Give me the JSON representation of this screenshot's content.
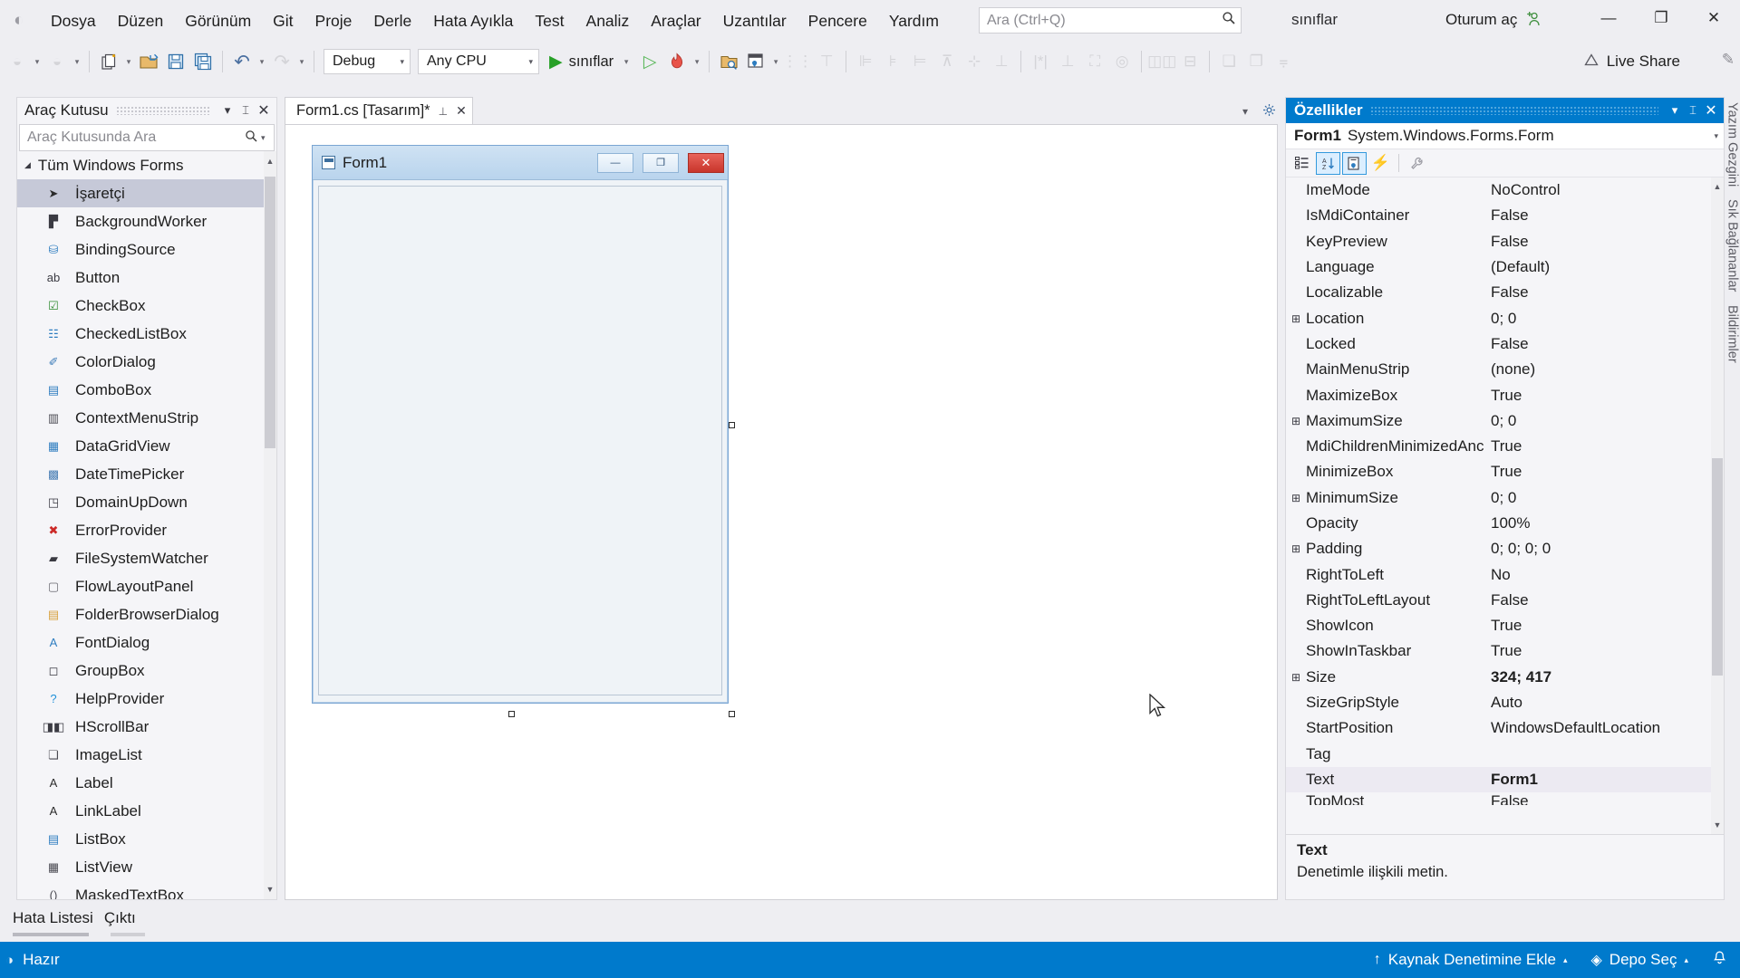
{
  "titlebar": {
    "back_icon": "back-arrow-icon",
    "menus": [
      "Dosya",
      "Düzen",
      "Görünüm",
      "Git",
      "Proje",
      "Derle",
      "Hata Ayıkla",
      "Test",
      "Analiz",
      "Araçlar",
      "Uzantılar",
      "Pencere",
      "Yardım"
    ],
    "quick_search_placeholder": "Ara (Ctrl+Q)",
    "quick_search_value": "",
    "solution_name": "sınıflar",
    "signin_label": "Oturum aç",
    "window_buttons": {
      "minimize": "—",
      "restore": "❐",
      "close": "✕"
    }
  },
  "toolbar": {
    "nav_back": "◒",
    "nav_forward": "◒",
    "new_project": "new-project-icon",
    "open_file": "open-file-icon",
    "save": "save-icon",
    "save_all": "save-all-icon",
    "undo": "↶",
    "redo": "↷",
    "configuration": "Debug",
    "platform": "Any CPU",
    "start_label": "sınıflar",
    "live_share_label": "Live Share",
    "overflow": "⩦"
  },
  "toolbox": {
    "title": "Araç Kutusu",
    "search_placeholder": "Araç Kutusunda Ara",
    "search_value": "",
    "group_label": "Tüm Windows Forms",
    "items": [
      {
        "label": "İşaretçi",
        "icon": "pointer-icon",
        "glyph": "➤",
        "color": "#2b2b2b",
        "selected": true
      },
      {
        "label": "BackgroundWorker",
        "icon": "background-worker-icon",
        "glyph": "▛",
        "color": "#3a3a42",
        "selected": false
      },
      {
        "label": "BindingSource",
        "icon": "binding-source-icon",
        "glyph": "⛁",
        "color": "#2e7dc0",
        "selected": false
      },
      {
        "label": "Button",
        "icon": "button-icon",
        "glyph": "ab",
        "color": "#3a3a42",
        "selected": false
      },
      {
        "label": "CheckBox",
        "icon": "checkbox-icon",
        "glyph": "☑",
        "color": "#2f8a2f",
        "selected": false
      },
      {
        "label": "CheckedListBox",
        "icon": "checked-listbox-icon",
        "glyph": "☷",
        "color": "#2e7dc0",
        "selected": false
      },
      {
        "label": "ColorDialog",
        "icon": "color-dialog-icon",
        "glyph": "✐",
        "color": "#3a7ab8",
        "selected": false
      },
      {
        "label": "ComboBox",
        "icon": "combobox-icon",
        "glyph": "▤",
        "color": "#2e7dc0",
        "selected": false
      },
      {
        "label": "ContextMenuStrip",
        "icon": "context-menu-strip-icon",
        "glyph": "▥",
        "color": "#4a4a52",
        "selected": false
      },
      {
        "label": "DataGridView",
        "icon": "datagridview-icon",
        "glyph": "▦",
        "color": "#2e7dc0",
        "selected": false
      },
      {
        "label": "DateTimePicker",
        "icon": "datetimepicker-icon",
        "glyph": "▩",
        "color": "#4a7fb5",
        "selected": false
      },
      {
        "label": "DomainUpDown",
        "icon": "domain-updown-icon",
        "glyph": "◳",
        "color": "#3a3a42",
        "selected": false
      },
      {
        "label": "ErrorProvider",
        "icon": "error-provider-icon",
        "glyph": "✖",
        "color": "#cc2a28",
        "selected": false
      },
      {
        "label": "FileSystemWatcher",
        "icon": "filesystem-watcher-icon",
        "glyph": "▰",
        "color": "#3a3a42",
        "selected": false
      },
      {
        "label": "FlowLayoutPanel",
        "icon": "flow-layout-panel-icon",
        "glyph": "▢",
        "color": "#6a6a72",
        "selected": false
      },
      {
        "label": "FolderBrowserDialog",
        "icon": "folder-browser-dialog-icon",
        "glyph": "▤",
        "color": "#d8a03c",
        "selected": false
      },
      {
        "label": "FontDialog",
        "icon": "font-dialog-icon",
        "glyph": "A",
        "color": "#2e7dc0",
        "selected": false
      },
      {
        "label": "GroupBox",
        "icon": "groupbox-icon",
        "glyph": "◻",
        "color": "#3a3a42",
        "selected": false
      },
      {
        "label": "HelpProvider",
        "icon": "help-provider-icon",
        "glyph": "?",
        "color": "#1e90d8",
        "selected": false
      },
      {
        "label": "HScrollBar",
        "icon": "hscrollbar-icon",
        "glyph": "◨◧",
        "color": "#3a3a42",
        "selected": false
      },
      {
        "label": "ImageList",
        "icon": "image-list-icon",
        "glyph": "❏",
        "color": "#4a4a52",
        "selected": false
      },
      {
        "label": "Label",
        "icon": "label-icon",
        "glyph": "A",
        "color": "#2b2b2b",
        "selected": false
      },
      {
        "label": "LinkLabel",
        "icon": "link-label-icon",
        "glyph": "A",
        "color": "#2b2b2b",
        "selected": false
      },
      {
        "label": "ListBox",
        "icon": "listbox-icon",
        "glyph": "▤",
        "color": "#2e7dc0",
        "selected": false
      },
      {
        "label": "ListView",
        "icon": "listview-icon",
        "glyph": "▦",
        "color": "#4a4a52",
        "selected": false
      },
      {
        "label": "MaskedTextBox",
        "icon": "masked-textbox-icon",
        "glyph": "()",
        "color": "#4a4a52",
        "selected": false
      }
    ]
  },
  "designer": {
    "tab_label": "Form1.cs [Tasarım]*",
    "tab_pin": "⊥",
    "tab_close": "✕",
    "form": {
      "title": "Form1",
      "minimize": "—",
      "maximize": "❐",
      "close": "✕"
    }
  },
  "properties": {
    "title": "Özellikler",
    "object_name": "Form1",
    "object_type": "System.Windows.Forms.Form",
    "tools": [
      {
        "name": "categorized-button",
        "glyph": "▤",
        "active": false
      },
      {
        "name": "alphabetical-button",
        "glyph": "⇅",
        "active": true
      },
      {
        "name": "properties-button",
        "glyph": "▣",
        "active": true
      },
      {
        "name": "events-button",
        "glyph": "⚡",
        "active": false
      },
      {
        "name": "property-pages-button",
        "glyph": "🔧",
        "active": false
      }
    ],
    "rows": [
      {
        "name": "ImeMode",
        "value": "NoControl",
        "expandable": false,
        "bold": false,
        "selected": false
      },
      {
        "name": "IsMdiContainer",
        "value": "False",
        "expandable": false,
        "bold": false,
        "selected": false
      },
      {
        "name": "KeyPreview",
        "value": "False",
        "expandable": false,
        "bold": false,
        "selected": false
      },
      {
        "name": "Language",
        "value": "(Default)",
        "expandable": false,
        "bold": false,
        "selected": false
      },
      {
        "name": "Localizable",
        "value": "False",
        "expandable": false,
        "bold": false,
        "selected": false
      },
      {
        "name": "Location",
        "value": "0; 0",
        "expandable": true,
        "bold": false,
        "selected": false
      },
      {
        "name": "Locked",
        "value": "False",
        "expandable": false,
        "bold": false,
        "selected": false
      },
      {
        "name": "MainMenuStrip",
        "value": "(none)",
        "expandable": false,
        "bold": false,
        "selected": false
      },
      {
        "name": "MaximizeBox",
        "value": "True",
        "expandable": false,
        "bold": false,
        "selected": false
      },
      {
        "name": "MaximumSize",
        "value": "0; 0",
        "expandable": true,
        "bold": false,
        "selected": false
      },
      {
        "name": "MdiChildrenMinimizedAnc",
        "value": "True",
        "expandable": false,
        "bold": false,
        "selected": false
      },
      {
        "name": "MinimizeBox",
        "value": "True",
        "expandable": false,
        "bold": false,
        "selected": false
      },
      {
        "name": "MinimumSize",
        "value": "0; 0",
        "expandable": true,
        "bold": false,
        "selected": false
      },
      {
        "name": "Opacity",
        "value": "100%",
        "expandable": false,
        "bold": false,
        "selected": false
      },
      {
        "name": "Padding",
        "value": "0; 0; 0; 0",
        "expandable": true,
        "bold": false,
        "selected": false
      },
      {
        "name": "RightToLeft",
        "value": "No",
        "expandable": false,
        "bold": false,
        "selected": false
      },
      {
        "name": "RightToLeftLayout",
        "value": "False",
        "expandable": false,
        "bold": false,
        "selected": false
      },
      {
        "name": "ShowIcon",
        "value": "True",
        "expandable": false,
        "bold": false,
        "selected": false
      },
      {
        "name": "ShowInTaskbar",
        "value": "True",
        "expandable": false,
        "bold": false,
        "selected": false
      },
      {
        "name": "Size",
        "value": "324; 417",
        "expandable": true,
        "bold": true,
        "selected": false
      },
      {
        "name": "SizeGripStyle",
        "value": "Auto",
        "expandable": false,
        "bold": false,
        "selected": false
      },
      {
        "name": "StartPosition",
        "value": "WindowsDefaultLocation",
        "expandable": false,
        "bold": false,
        "selected": false
      },
      {
        "name": "Tag",
        "value": "",
        "expandable": false,
        "bold": false,
        "selected": false
      },
      {
        "name": "Text",
        "value": "Form1",
        "expandable": false,
        "bold": true,
        "selected": true
      },
      {
        "name": "TopMost",
        "value": "False",
        "expandable": false,
        "bold": false,
        "selected": false,
        "clipped": true
      }
    ],
    "description_title": "Text",
    "description_body": "Denetimle ilişkili metin."
  },
  "vertical_tabs": [
    "Yazım Gezgini",
    "Sık Bağlananlar",
    "Bildirimler"
  ],
  "bottom_tabs": [
    {
      "label": "Hata Listesi"
    },
    {
      "label": "Çıktı"
    }
  ],
  "statusbar": {
    "ready_text": "Hazır",
    "add_to_source_control": "Kaynak Denetimine Ekle",
    "select_repository": "Depo Seç",
    "bell_icon": "bell-icon",
    "accent_color": "#007acc"
  }
}
